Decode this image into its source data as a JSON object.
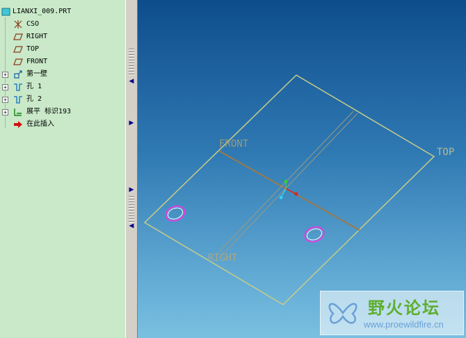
{
  "model_tree": {
    "root": "LIANXI_009.PRT",
    "items": [
      {
        "label": "CSO",
        "icon": "csys-icon",
        "expandable": false
      },
      {
        "label": "RIGHT",
        "icon": "datum-plane-icon",
        "expandable": false
      },
      {
        "label": "TOP",
        "icon": "datum-plane-icon",
        "expandable": false
      },
      {
        "label": "FRONT",
        "icon": "datum-plane-icon",
        "expandable": false
      },
      {
        "label": "第一壁",
        "icon": "sheetmetal-wall-icon",
        "expandable": true
      },
      {
        "label": "孔 1",
        "icon": "hole-icon",
        "expandable": true
      },
      {
        "label": "孔 2",
        "icon": "hole-icon",
        "expandable": true
      },
      {
        "label": "展平 标识193",
        "icon": "flatten-icon",
        "expandable": true
      },
      {
        "label": "在此插入",
        "icon": "insert-here-arrow-icon",
        "expandable": false
      }
    ]
  },
  "viewport": {
    "datum_labels": {
      "front": "FRONT",
      "top": "TOP",
      "right": "RIGHT"
    }
  },
  "watermark": {
    "text_cn": "野火论坛",
    "url": "www.proewildfire.cn"
  },
  "colors": {
    "tree_bg": "#c9e9c9",
    "plate_edge": "#c8cc88",
    "hole": "#e040e0",
    "viewport_top": "#0e4d8c",
    "viewport_bottom": "#79c0e0"
  }
}
